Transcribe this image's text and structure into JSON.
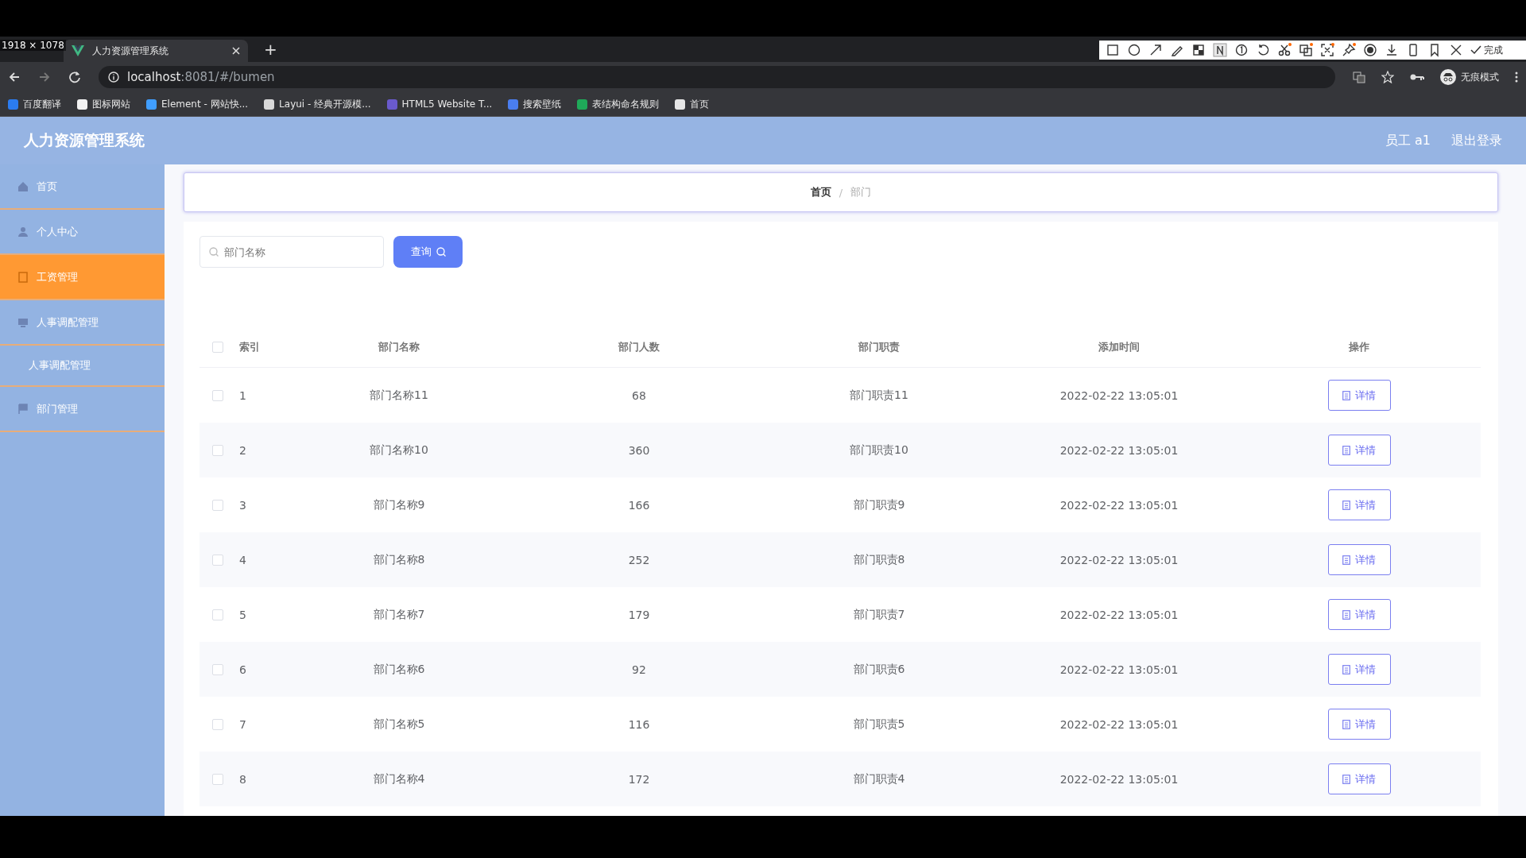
{
  "screen_overlay": {
    "size_label": "1918 × 1078",
    "done_label": "完成"
  },
  "browser": {
    "tab_title": "人力资源管理系统",
    "new_tab": "+",
    "url_host": "localhost",
    "url_rest": ":8081/#/bumen",
    "profile": "无痕模式",
    "bookmarks": [
      {
        "label": "百度翻译",
        "color": "#2b7cf0"
      },
      {
        "label": "图标网站",
        "color": "#f2f2f2"
      },
      {
        "label": "Element - 网站快...",
        "color": "#409eff"
      },
      {
        "label": "Layui - 经典开源模...",
        "color": "#d9d9d9"
      },
      {
        "label": "HTML5 Website T...",
        "color": "#6a5acd"
      },
      {
        "label": "搜索壁纸",
        "color": "#4a7ef0"
      },
      {
        "label": "表结构命名规则",
        "color": "#1faa59"
      },
      {
        "label": "首页",
        "color": "#e6e6e6"
      }
    ]
  },
  "app": {
    "title": "人力资源管理系统",
    "user": "员工 a1",
    "logout": "退出登录"
  },
  "sidebar": {
    "items": [
      {
        "label": "首页",
        "kind": "home",
        "selected": false
      },
      {
        "label": "个人中心",
        "kind": "user",
        "selected": false
      },
      {
        "label": "工资管理",
        "kind": "doc",
        "selected": true
      },
      {
        "label": "人事调配管理",
        "kind": "monitor",
        "selected": false,
        "children": [
          {
            "label": "人事调配管理",
            "selected": false
          }
        ]
      },
      {
        "label": "部门管理",
        "kind": "flag",
        "selected": false
      }
    ]
  },
  "breadcrumb": {
    "items": [
      "首页",
      "部门"
    ],
    "separator": "/"
  },
  "search": {
    "placeholder": "部门名称",
    "button": "查询"
  },
  "table": {
    "header_checked": false,
    "columns": [
      "索引",
      "部门名称",
      "部门人数",
      "部门职责",
      "添加时间",
      "操作"
    ],
    "rows": [
      {
        "checked": false,
        "cells": [
          "1",
          "部门名称11",
          "68",
          "部门职责11",
          "2022-02-22 13:05:01"
        ],
        "action": "详情"
      },
      {
        "checked": false,
        "cells": [
          "2",
          "部门名称10",
          "360",
          "部门职责10",
          "2022-02-22 13:05:01"
        ],
        "action": "详情"
      },
      {
        "checked": false,
        "cells": [
          "3",
          "部门名称9",
          "166",
          "部门职责9",
          "2022-02-22 13:05:01"
        ],
        "action": "详情"
      },
      {
        "checked": false,
        "cells": [
          "4",
          "部门名称8",
          "252",
          "部门职责8",
          "2022-02-22 13:05:01"
        ],
        "action": "详情"
      },
      {
        "checked": false,
        "cells": [
          "5",
          "部门名称7",
          "179",
          "部门职责7",
          "2022-02-22 13:05:01"
        ],
        "action": "详情"
      },
      {
        "checked": false,
        "cells": [
          "6",
          "部门名称6",
          "92",
          "部门职责6",
          "2022-02-22 13:05:01"
        ],
        "action": "详情"
      },
      {
        "checked": false,
        "cells": [
          "7",
          "部门名称5",
          "116",
          "部门职责5",
          "2022-02-22 13:05:01"
        ],
        "action": "详情"
      },
      {
        "checked": false,
        "cells": [
          "8",
          "部门名称4",
          "172",
          "部门职责4",
          "2022-02-22 13:05:01"
        ],
        "action": "详情"
      }
    ]
  }
}
